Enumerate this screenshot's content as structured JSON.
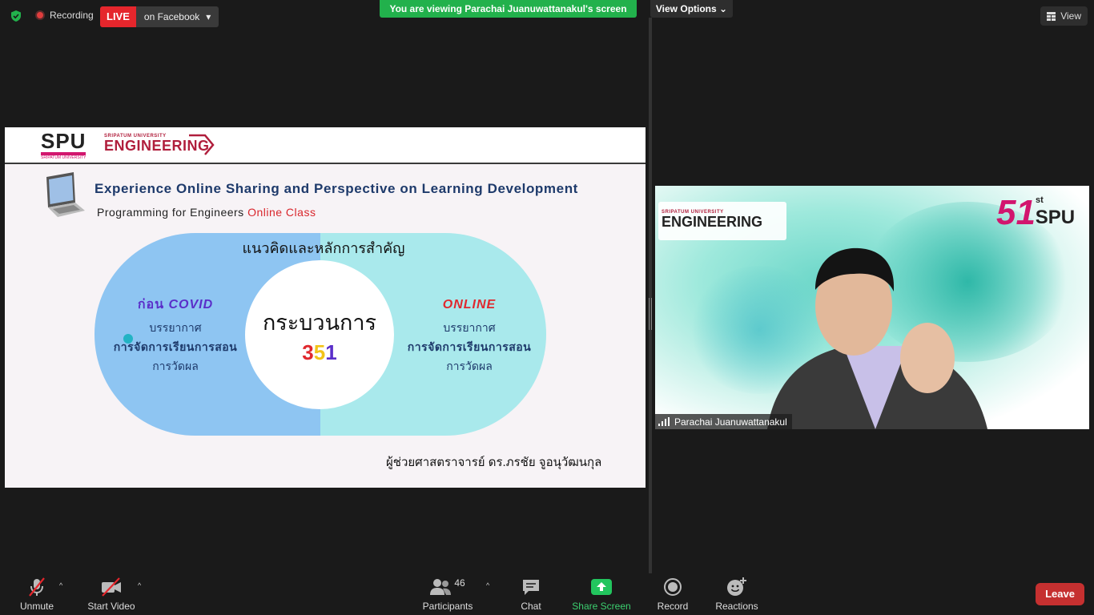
{
  "topbar": {
    "recording_label": "Recording",
    "live_label": "LIVE",
    "live_target": "on Facebook",
    "viewing_banner": "You are viewing Parachai Juanuwattanakul's screen",
    "view_options_label": "View Options",
    "view_label": "View"
  },
  "slide": {
    "logo_spu": "SPU",
    "logo_spu_small": "SRIPATUM UNIVERSITY",
    "logo_eng_small": "SRIPATUM UNIVERSITY",
    "logo_eng": "ENGINEERING",
    "title": "Experience Online Sharing and Perspective on Learning Development",
    "subtitle_prefix": "Programming for Engineers ",
    "subtitle_highlight": "Online Class",
    "concept_heading": "แนวคิดและหลักการสำคัญ",
    "center_label": "กระบวนการ",
    "center_digits": [
      "3",
      "5",
      "1"
    ],
    "left": {
      "heading_thai": "ก่อน ",
      "heading_en": "COVID",
      "line1": "บรรยากาศ",
      "line2": "การจัดการเรียนการสอน",
      "line3": "การวัดผล"
    },
    "right": {
      "heading": "ONLINE",
      "line1": "บรรยากาศ",
      "line2": "การจัดการเรียนการสอน",
      "line3": "การวัดผล"
    },
    "author": "ผู้ช่วยศาสตราจารย์ ดร.ภรชัย จูอนุวัฒนกุล"
  },
  "video": {
    "eng_small": "SRIPATUM UNIVERSITY",
    "eng_big": "ENGINEERING",
    "badge_number": "51",
    "badge_suffix": "st",
    "badge_spu": "SPU",
    "participant_name": "Parachai Juanuwattanakul"
  },
  "toolbar": {
    "unmute": "Unmute",
    "start_video": "Start Video",
    "participants": "Participants",
    "participants_count": "46",
    "chat": "Chat",
    "share_screen": "Share Screen",
    "record": "Record",
    "reactions": "Reactions",
    "leave": "Leave"
  },
  "colors": {
    "live_red": "#e5262c",
    "banner_green": "#22b14c",
    "leave_red": "#c53030",
    "digit_colors": [
      "#e0282e",
      "#f2c318",
      "#5a2ec9"
    ]
  }
}
